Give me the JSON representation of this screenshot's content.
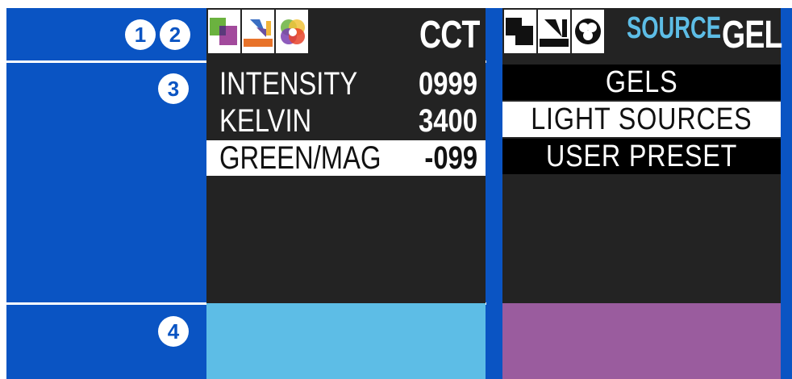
{
  "callouts": [
    "1",
    "2",
    "3",
    "4"
  ],
  "left_panel": {
    "title": "CCT",
    "mode_icons": [
      "color-blocks-icon",
      "slider-arrow-icon",
      "rgb-circles-icon"
    ],
    "rows": [
      {
        "label": "INTENSITY",
        "value": "0999",
        "selected": false
      },
      {
        "label": "KELVIN",
        "value": "3400",
        "selected": false
      },
      {
        "label": "GREEN/MAG",
        "value": "-099",
        "selected": true
      }
    ],
    "preview_color": "#5dbde6"
  },
  "right_panel": {
    "title_small": "SOURCE",
    "title_large": "GEL",
    "mode_icons": [
      "blocks-mono-icon",
      "arrow-mono-icon",
      "circles-mono-icon"
    ],
    "items": [
      {
        "label": "GELS",
        "selected": false
      },
      {
        "label": "LIGHT SOURCES",
        "selected": true
      },
      {
        "label": "USER PRESET",
        "selected": false
      }
    ],
    "preview_color": "#9a5c9e"
  },
  "colors": {
    "accent_blue": "#0a54c3",
    "screen_bg": "#232323"
  }
}
